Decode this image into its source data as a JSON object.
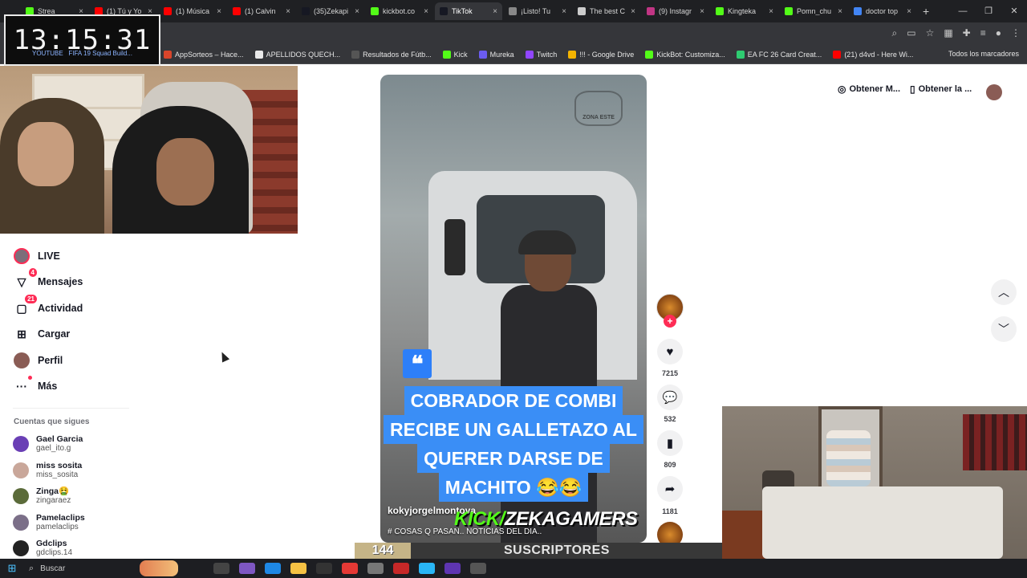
{
  "browser": {
    "tabs": [
      {
        "label": "Strea",
        "favicon": "kick",
        "color": "#53fc18"
      },
      {
        "label": "(1) Tú y Yo",
        "favicon": "youtube",
        "color": "#ff0000"
      },
      {
        "label": "(1) Música",
        "favicon": "youtube",
        "color": "#ff0000"
      },
      {
        "label": "(1) Calvin",
        "favicon": "youtube",
        "color": "#ff0000"
      },
      {
        "label": "(35)Zekapi",
        "favicon": "tiktok",
        "color": "#161823"
      },
      {
        "label": "kickbot.co",
        "favicon": "kickbot",
        "color": "#53fc18"
      },
      {
        "label": "TikTok",
        "favicon": "tiktok",
        "color": "#161823",
        "active": true
      },
      {
        "label": "¡Listo! Tu",
        "favicon": "chat",
        "color": "#888888"
      },
      {
        "label": "The best C",
        "favicon": "shield",
        "color": "#cccccc"
      },
      {
        "label": "(9) Instagr",
        "favicon": "instagram",
        "color": "#c13584"
      },
      {
        "label": "Kingteka",
        "favicon": "kick",
        "color": "#53fc18"
      },
      {
        "label": "Pomn_chu",
        "favicon": "kick",
        "color": "#53fc18"
      },
      {
        "label": "doctor top",
        "favicon": "google",
        "color": "#4285f4"
      }
    ],
    "new_tab": "+",
    "window_controls": {
      "minimize": "—",
      "restore": "❐",
      "close": "✕"
    },
    "bookmarks": [
      {
        "label": "AppSorteos – Hace...",
        "color": "#d9452b"
      },
      {
        "label": "APELLIDOS QUECH...",
        "color": "#e9e9e9"
      },
      {
        "label": "Resultados de Fútb...",
        "color": "#555555"
      },
      {
        "label": "Kick",
        "color": "#53fc18"
      },
      {
        "label": "Mureka",
        "color": "#6b5cf0"
      },
      {
        "label": "Twitch",
        "color": "#9146ff"
      },
      {
        "label": "!!! - Google Drive",
        "color": "#f4b400"
      },
      {
        "label": "KickBot: Customiza...",
        "color": "#53fc18"
      },
      {
        "label": "EA FC 26 Card Creat...",
        "color": "#2ecc71"
      },
      {
        "label": "(21) d4vd - Here Wi...",
        "color": "#ff0000"
      }
    ],
    "all_bookmarks": "Todos los marcadores",
    "partial_bookmarks": [
      "YOUTUBE",
      "FIFA 19 Squad Build..."
    ]
  },
  "clock": {
    "time": "13:15:31"
  },
  "sidebar": {
    "items": [
      {
        "label": "LIVE",
        "icon": "live-avatar-icon"
      },
      {
        "label": "Mensajes",
        "icon": "messages-icon",
        "badge": "4"
      },
      {
        "label": "Actividad",
        "icon": "activity-icon",
        "badge": "21"
      },
      {
        "label": "Cargar",
        "icon": "upload-icon"
      },
      {
        "label": "Perfil",
        "icon": "profile-avatar-icon"
      },
      {
        "label": "Más",
        "icon": "more-icon",
        "dot": true
      }
    ],
    "following_title": "Cuentas que sigues",
    "accounts": [
      {
        "name": "Gael Garcia",
        "handle": "gael_ito.g",
        "color": "#6a3fb5"
      },
      {
        "name": "miss sosita",
        "handle": "miss_sosita",
        "color": "#c9a79a"
      },
      {
        "name": "Zinga🤮",
        "handle": "zingaraez",
        "color": "#5b6b3a"
      },
      {
        "name": "Pamelaclips",
        "handle": "pamelaclips",
        "color": "#7b6f88"
      },
      {
        "name": "Gdclips",
        "handle": "gdclips.14",
        "color": "#222222"
      }
    ]
  },
  "video": {
    "caption_lines": [
      "COBRADOR DE COMBI",
      "RECIBE UN GALLETAZO AL",
      "QUERER DARSE DE",
      "MACHITO 😂😂"
    ],
    "watermark": "ZONA ESTE",
    "username": "kokyjorgelmontoya",
    "description": "# COSAS Q PASAN.. NOTICIAS DEL DIA..",
    "quote_icon": "❝"
  },
  "actions": {
    "likes": "7215",
    "comments": "532",
    "saves": "809",
    "shares": "1181"
  },
  "top_right": {
    "get_coins": "Obtener M...",
    "get_app": "Obtener la ..."
  },
  "overlay": {
    "kick_prefix": "KICK/",
    "kick_channel": "ZEKAGAMERS",
    "sub_count": "144",
    "sub_label": "SUSCRIPTORES"
  },
  "taskbar": {
    "search_placeholder": "Buscar"
  }
}
